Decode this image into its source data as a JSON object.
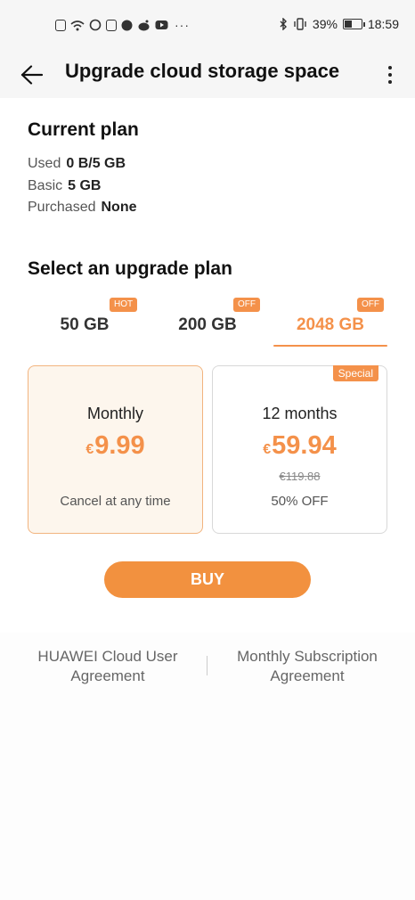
{
  "status_bar": {
    "battery_percent": "39%",
    "battery_level": 0.39,
    "time": "18:59",
    "notification_icons": [
      "sim-icon",
      "wifi-icon",
      "whatsapp-icon",
      "mail-icon",
      "facebook-icon",
      "reddit-icon",
      "youtube-icon"
    ],
    "more_dots": "···",
    "system_icons": [
      "nfc-icon",
      "bluetooth-icon",
      "vibrate-icon"
    ]
  },
  "header": {
    "title": "Upgrade cloud storage space"
  },
  "current_plan": {
    "title": "Current plan",
    "rows": [
      {
        "label": "Used",
        "value": "0 B/5 GB"
      },
      {
        "label": "Basic",
        "value": "5 GB"
      },
      {
        "label": "Purchased",
        "value": "None"
      }
    ]
  },
  "upgrade": {
    "title": "Select an upgrade plan",
    "tabs": [
      {
        "label": "50 GB",
        "badge": "HOT",
        "active": false
      },
      {
        "label": "200 GB",
        "badge": "OFF",
        "active": false
      },
      {
        "label": "2048 GB",
        "badge": "OFF",
        "active": true
      }
    ],
    "plans": [
      {
        "period": "Monthly",
        "currency": "€",
        "price": "9.99",
        "note": "Cancel at any time",
        "selected": true
      },
      {
        "period": "12 months",
        "currency": "€",
        "price": "59.94",
        "original_price": "€119.88",
        "note": "50% OFF",
        "badge": "Special",
        "selected": false
      }
    ],
    "buy_label": "BUY"
  },
  "footer": {
    "links": [
      "HUAWEI Cloud User Agreement",
      "Monthly Subscription Agreement"
    ]
  },
  "colors": {
    "accent": "#f4914a",
    "button": "#f2913f"
  }
}
